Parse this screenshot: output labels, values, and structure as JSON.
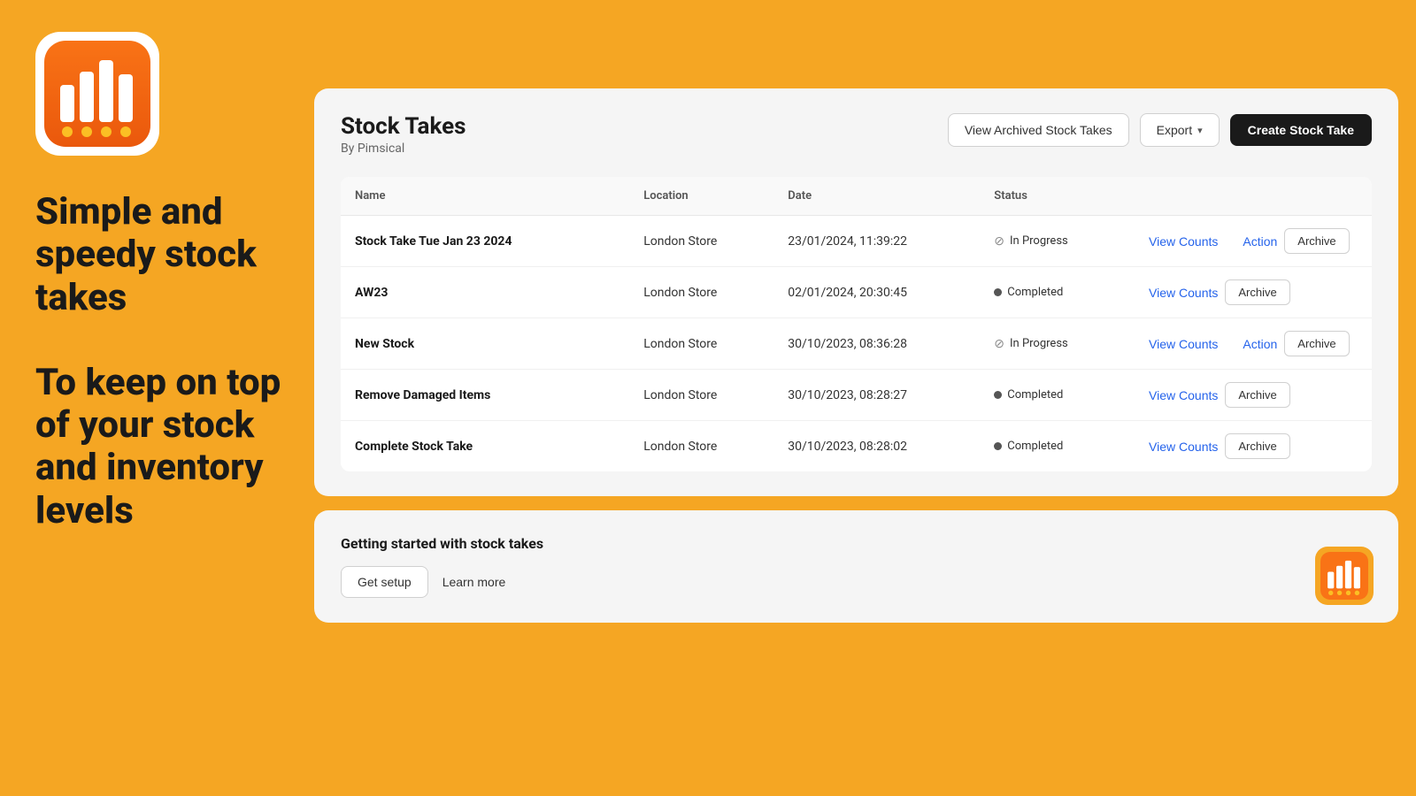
{
  "branding": {
    "tagline1": "Simple and speedy stock takes",
    "tagline2": "To keep on top of your stock and inventory levels"
  },
  "header": {
    "title": "Stock Takes",
    "subtitle": "By Pimsical",
    "view_archived_label": "View Archived Stock Takes",
    "export_label": "Export",
    "create_label": "Create Stock Take"
  },
  "table": {
    "columns": [
      "Name",
      "Location",
      "Date",
      "Status"
    ],
    "rows": [
      {
        "name": "Stock Take Tue Jan 23 2024",
        "location": "London Store",
        "date": "23/01/2024, 11:39:22",
        "status": "In Progress",
        "status_type": "inprogress",
        "has_action": true
      },
      {
        "name": "AW23",
        "location": "London Store",
        "date": "02/01/2024, 20:30:45",
        "status": "Completed",
        "status_type": "completed",
        "has_action": false
      },
      {
        "name": "New Stock",
        "location": "London Store",
        "date": "30/10/2023, 08:36:28",
        "status": "In Progress",
        "status_type": "inprogress",
        "has_action": true
      },
      {
        "name": "Remove Damaged Items",
        "location": "London Store",
        "date": "30/10/2023, 08:28:27",
        "status": "Completed",
        "status_type": "completed",
        "has_action": false
      },
      {
        "name": "Complete Stock Take",
        "location": "London Store",
        "date": "30/10/2023, 08:28:02",
        "status": "Completed",
        "status_type": "completed",
        "has_action": false
      }
    ],
    "view_counts_label": "View Counts",
    "action_label": "Action",
    "archive_label": "Archive"
  },
  "getting_started": {
    "title": "Getting started with stock takes",
    "setup_label": "Get setup",
    "learn_label": "Learn more"
  }
}
